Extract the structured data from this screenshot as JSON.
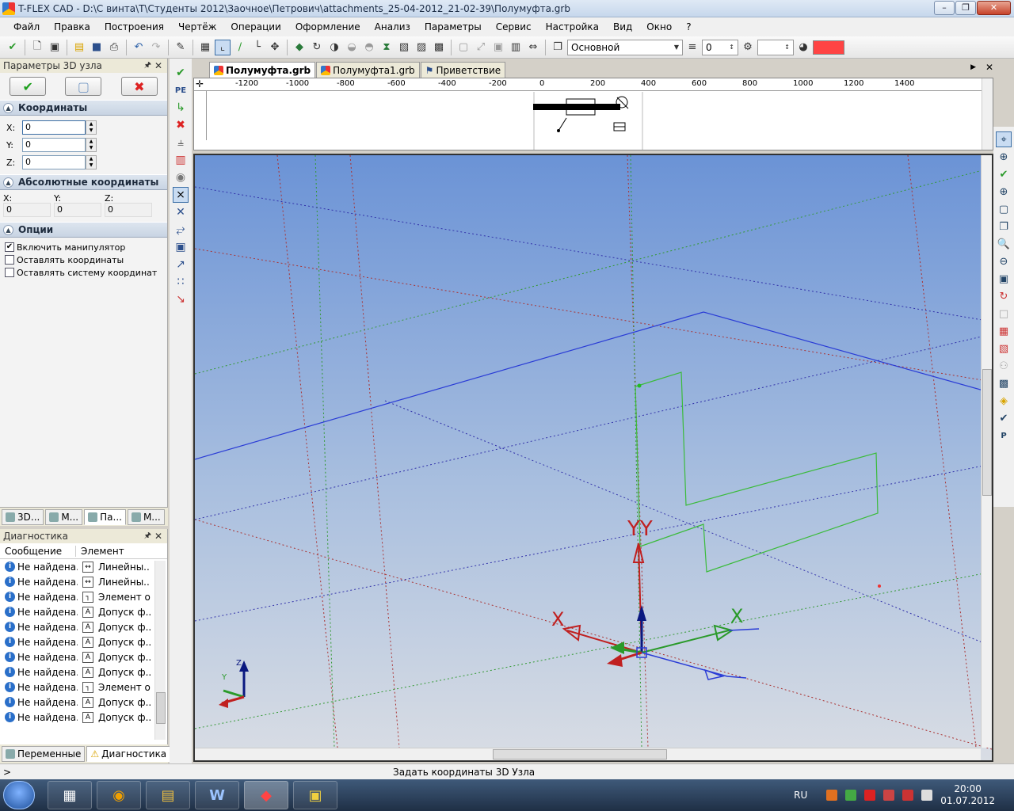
{
  "window": {
    "title": "T-FLEX CAD - D:\\С винта\\T\\Студенты 2012\\Заочное\\Петрович\\attachments_25-04-2012_21-02-39\\Полумуфта.grb"
  },
  "menu": [
    "Файл",
    "Правка",
    "Построения",
    "Чертёж",
    "Операции",
    "Оформление",
    "Анализ",
    "Параметры",
    "Сервис",
    "Настройка",
    "Вид",
    "Окно",
    "?"
  ],
  "toolbar": {
    "layer": "Основной",
    "level": "0",
    "accent_color": "#ff4444"
  },
  "params_panel": {
    "title": "Параметры 3D узла",
    "section_coords": "Координаты",
    "x_label": "X:",
    "y_label": "Y:",
    "z_label": "Z:",
    "x_value": "0",
    "y_value": "0",
    "z_value": "0",
    "section_abs": "Абсолютные координаты",
    "abs_x_label": "X:",
    "abs_y_label": "Y:",
    "abs_z_label": "Z:",
    "abs_x": "0",
    "abs_y": "0",
    "abs_z": "0",
    "section_options": "Опции",
    "opt_manip": "Включить манипулятор",
    "opt_keep_coords": "Оставлять координаты",
    "opt_keep_cs": "Оставлять систему координат",
    "opt_manip_checked": true
  },
  "panel_tabs": [
    "3D...",
    "М...",
    "Па...",
    "М..."
  ],
  "diagnostics": {
    "title": "Диагностика",
    "col_message": "Сообщение",
    "col_element": "Элемент",
    "rows": [
      {
        "msg": "Не найдена...",
        "el": "Линейны..."
      },
      {
        "msg": "Не найдена...",
        "el": "Линейны..."
      },
      {
        "msg": "Не найдена...",
        "el": "Элемент о..."
      },
      {
        "msg": "Не найдена...",
        "el": "Допуск ф..."
      },
      {
        "msg": "Не найдена...",
        "el": "Допуск ф..."
      },
      {
        "msg": "Не найдена...",
        "el": "Допуск ф..."
      },
      {
        "msg": "Не найдена...",
        "el": "Допуск ф..."
      },
      {
        "msg": "Не найдена...",
        "el": "Допуск ф..."
      },
      {
        "msg": "Не найдена...",
        "el": "Элемент о..."
      },
      {
        "msg": "Не найдена...",
        "el": "Допуск ф..."
      },
      {
        "msg": "Не найдена...",
        "el": "Допуск ф..."
      }
    ]
  },
  "bottom_tabs": [
    "Переменные",
    "Диагностика"
  ],
  "doc_tabs": [
    "Полумуфта.grb",
    "Полумуфта1.grb",
    "Приветствие"
  ],
  "ruler_labels": [
    "-1200",
    "-1000",
    "-800",
    "-600",
    "-400",
    "-200",
    "0",
    "200",
    "400",
    "600",
    "800",
    "1000",
    "1200",
    "1400"
  ],
  "viewport": {
    "axis_labels": {
      "y": "YY",
      "x_red": "X",
      "x_green": "X",
      "corner_z": "Z",
      "corner_y": "Y"
    }
  },
  "status": {
    "prompt": ">",
    "text": "Задать координаты 3D Узла"
  },
  "tray": {
    "lang": "RU",
    "time": "20:00",
    "date": "01.07.2012"
  }
}
